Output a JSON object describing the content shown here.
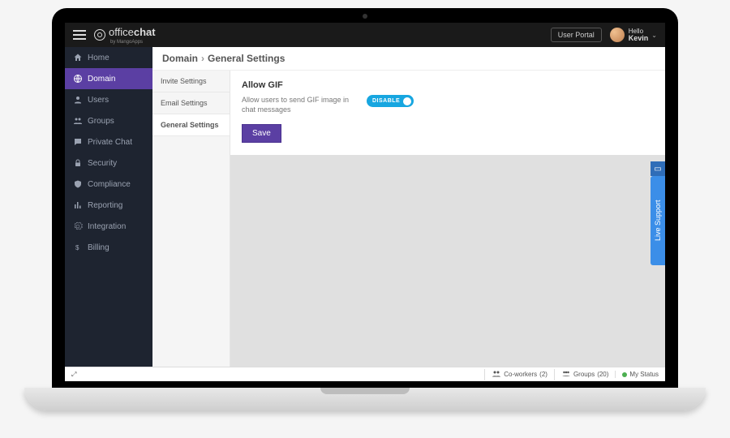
{
  "brand": {
    "name_light": "office",
    "name_bold": "chat",
    "byline": "by MangoApps"
  },
  "header": {
    "portal_btn": "User Portal",
    "greeting": "Hello",
    "username": "Kevin"
  },
  "sidebar": {
    "items": [
      {
        "label": "Home"
      },
      {
        "label": "Domain"
      },
      {
        "label": "Users"
      },
      {
        "label": "Groups"
      },
      {
        "label": "Private Chat"
      },
      {
        "label": "Security"
      },
      {
        "label": "Compliance"
      },
      {
        "label": "Reporting"
      },
      {
        "label": "Integration"
      },
      {
        "label": "Billing"
      }
    ]
  },
  "breadcrumb": {
    "root": "Domain",
    "leaf": "General Settings"
  },
  "subnav": {
    "items": [
      {
        "label": "Invite Settings"
      },
      {
        "label": "Email Settings"
      },
      {
        "label": "General Settings"
      }
    ]
  },
  "settings": {
    "allow_gif_title": "Allow GIF",
    "allow_gif_desc": "Allow users to send GIF image in chat messages",
    "toggle_label": "DISABLE",
    "save_label": "Save"
  },
  "support": {
    "label": "Live Support"
  },
  "footer": {
    "coworkers_label": "Co-workers",
    "coworkers_count": "(2)",
    "groups_label": "Groups",
    "groups_count": "(20)",
    "status_label": "My Status"
  }
}
